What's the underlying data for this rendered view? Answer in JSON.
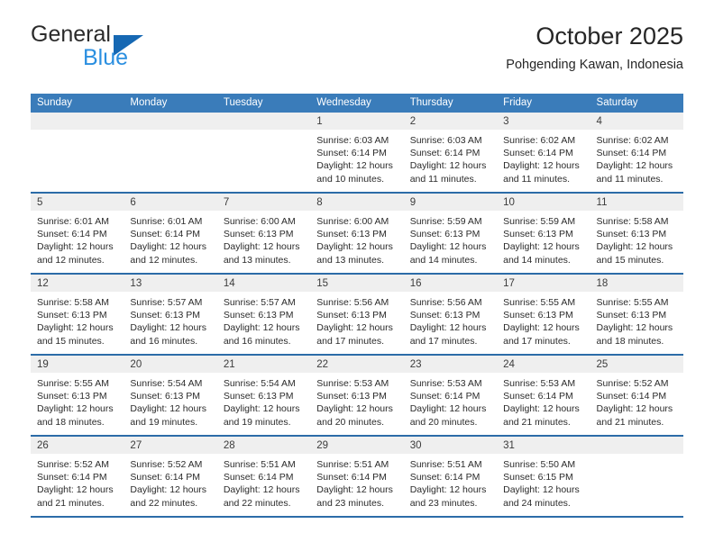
{
  "brand": {
    "name_part1": "General",
    "name_part2": "Blue",
    "triangle_color": "#1668b3",
    "blue_color": "#2b8fe0"
  },
  "header": {
    "title": "October 2025",
    "location": "Pohgending Kawan, Indonesia"
  },
  "theme": {
    "header_bar": "#3a7cba",
    "row_divider": "#2c6ca8",
    "daynum_band": "#efefef",
    "text": "#2b2b2b"
  },
  "weekdays": [
    "Sunday",
    "Monday",
    "Tuesday",
    "Wednesday",
    "Thursday",
    "Friday",
    "Saturday"
  ],
  "weeks": [
    [
      {
        "day": "",
        "lines": []
      },
      {
        "day": "",
        "lines": []
      },
      {
        "day": "",
        "lines": []
      },
      {
        "day": "1",
        "lines": [
          "Sunrise: 6:03 AM",
          "Sunset: 6:14 PM",
          "Daylight: 12 hours",
          "and 10 minutes."
        ]
      },
      {
        "day": "2",
        "lines": [
          "Sunrise: 6:03 AM",
          "Sunset: 6:14 PM",
          "Daylight: 12 hours",
          "and 11 minutes."
        ]
      },
      {
        "day": "3",
        "lines": [
          "Sunrise: 6:02 AM",
          "Sunset: 6:14 PM",
          "Daylight: 12 hours",
          "and 11 minutes."
        ]
      },
      {
        "day": "4",
        "lines": [
          "Sunrise: 6:02 AM",
          "Sunset: 6:14 PM",
          "Daylight: 12 hours",
          "and 11 minutes."
        ]
      }
    ],
    [
      {
        "day": "5",
        "lines": [
          "Sunrise: 6:01 AM",
          "Sunset: 6:14 PM",
          "Daylight: 12 hours",
          "and 12 minutes."
        ]
      },
      {
        "day": "6",
        "lines": [
          "Sunrise: 6:01 AM",
          "Sunset: 6:14 PM",
          "Daylight: 12 hours",
          "and 12 minutes."
        ]
      },
      {
        "day": "7",
        "lines": [
          "Sunrise: 6:00 AM",
          "Sunset: 6:13 PM",
          "Daylight: 12 hours",
          "and 13 minutes."
        ]
      },
      {
        "day": "8",
        "lines": [
          "Sunrise: 6:00 AM",
          "Sunset: 6:13 PM",
          "Daylight: 12 hours",
          "and 13 minutes."
        ]
      },
      {
        "day": "9",
        "lines": [
          "Sunrise: 5:59 AM",
          "Sunset: 6:13 PM",
          "Daylight: 12 hours",
          "and 14 minutes."
        ]
      },
      {
        "day": "10",
        "lines": [
          "Sunrise: 5:59 AM",
          "Sunset: 6:13 PM",
          "Daylight: 12 hours",
          "and 14 minutes."
        ]
      },
      {
        "day": "11",
        "lines": [
          "Sunrise: 5:58 AM",
          "Sunset: 6:13 PM",
          "Daylight: 12 hours",
          "and 15 minutes."
        ]
      }
    ],
    [
      {
        "day": "12",
        "lines": [
          "Sunrise: 5:58 AM",
          "Sunset: 6:13 PM",
          "Daylight: 12 hours",
          "and 15 minutes."
        ]
      },
      {
        "day": "13",
        "lines": [
          "Sunrise: 5:57 AM",
          "Sunset: 6:13 PM",
          "Daylight: 12 hours",
          "and 16 minutes."
        ]
      },
      {
        "day": "14",
        "lines": [
          "Sunrise: 5:57 AM",
          "Sunset: 6:13 PM",
          "Daylight: 12 hours",
          "and 16 minutes."
        ]
      },
      {
        "day": "15",
        "lines": [
          "Sunrise: 5:56 AM",
          "Sunset: 6:13 PM",
          "Daylight: 12 hours",
          "and 17 minutes."
        ]
      },
      {
        "day": "16",
        "lines": [
          "Sunrise: 5:56 AM",
          "Sunset: 6:13 PM",
          "Daylight: 12 hours",
          "and 17 minutes."
        ]
      },
      {
        "day": "17",
        "lines": [
          "Sunrise: 5:55 AM",
          "Sunset: 6:13 PM",
          "Daylight: 12 hours",
          "and 17 minutes."
        ]
      },
      {
        "day": "18",
        "lines": [
          "Sunrise: 5:55 AM",
          "Sunset: 6:13 PM",
          "Daylight: 12 hours",
          "and 18 minutes."
        ]
      }
    ],
    [
      {
        "day": "19",
        "lines": [
          "Sunrise: 5:55 AM",
          "Sunset: 6:13 PM",
          "Daylight: 12 hours",
          "and 18 minutes."
        ]
      },
      {
        "day": "20",
        "lines": [
          "Sunrise: 5:54 AM",
          "Sunset: 6:13 PM",
          "Daylight: 12 hours",
          "and 19 minutes."
        ]
      },
      {
        "day": "21",
        "lines": [
          "Sunrise: 5:54 AM",
          "Sunset: 6:13 PM",
          "Daylight: 12 hours",
          "and 19 minutes."
        ]
      },
      {
        "day": "22",
        "lines": [
          "Sunrise: 5:53 AM",
          "Sunset: 6:13 PM",
          "Daylight: 12 hours",
          "and 20 minutes."
        ]
      },
      {
        "day": "23",
        "lines": [
          "Sunrise: 5:53 AM",
          "Sunset: 6:14 PM",
          "Daylight: 12 hours",
          "and 20 minutes."
        ]
      },
      {
        "day": "24",
        "lines": [
          "Sunrise: 5:53 AM",
          "Sunset: 6:14 PM",
          "Daylight: 12 hours",
          "and 21 minutes."
        ]
      },
      {
        "day": "25",
        "lines": [
          "Sunrise: 5:52 AM",
          "Sunset: 6:14 PM",
          "Daylight: 12 hours",
          "and 21 minutes."
        ]
      }
    ],
    [
      {
        "day": "26",
        "lines": [
          "Sunrise: 5:52 AM",
          "Sunset: 6:14 PM",
          "Daylight: 12 hours",
          "and 21 minutes."
        ]
      },
      {
        "day": "27",
        "lines": [
          "Sunrise: 5:52 AM",
          "Sunset: 6:14 PM",
          "Daylight: 12 hours",
          "and 22 minutes."
        ]
      },
      {
        "day": "28",
        "lines": [
          "Sunrise: 5:51 AM",
          "Sunset: 6:14 PM",
          "Daylight: 12 hours",
          "and 22 minutes."
        ]
      },
      {
        "day": "29",
        "lines": [
          "Sunrise: 5:51 AM",
          "Sunset: 6:14 PM",
          "Daylight: 12 hours",
          "and 23 minutes."
        ]
      },
      {
        "day": "30",
        "lines": [
          "Sunrise: 5:51 AM",
          "Sunset: 6:14 PM",
          "Daylight: 12 hours",
          "and 23 minutes."
        ]
      },
      {
        "day": "31",
        "lines": [
          "Sunrise: 5:50 AM",
          "Sunset: 6:15 PM",
          "Daylight: 12 hours",
          "and 24 minutes."
        ]
      },
      {
        "day": "",
        "lines": []
      }
    ]
  ]
}
